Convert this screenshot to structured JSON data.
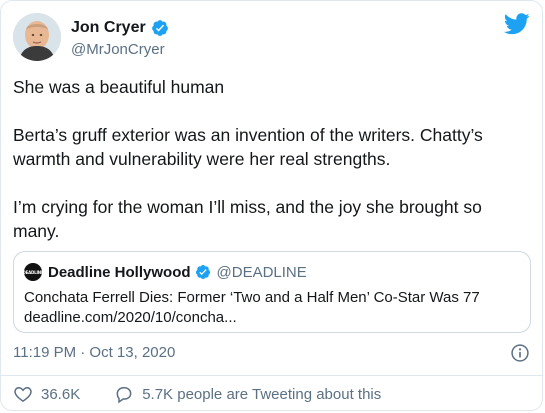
{
  "author": {
    "display_name": "Jon Cryer",
    "handle": "@MrJonCryer",
    "avatar_icon": "person-avatar"
  },
  "tweet": {
    "paragraphs": [
      "She was a beautiful human",
      "Berta’s gruff exterior was an invention of the writers. Chatty’s warmth and vulnerability were her real strengths.",
      "I’m crying for the woman I’ll miss, and the joy she brought so many."
    ],
    "timestamp": "11:19 PM · Oct 13, 2020"
  },
  "quoted": {
    "avatar_text": "DEADLINE",
    "display_name": "Deadline Hollywood",
    "handle": "@DEADLINE",
    "headline": "Conchata Ferrell Dies: Former ‘Two and a Half Men’ Co-Star Was 77",
    "link": "deadline.com/2020/10/concha..."
  },
  "actions": {
    "likes": "36.6K",
    "conversation": "5.7K people are Tweeting about this"
  },
  "colors": {
    "verified": "#1da1f2",
    "twitter_blue": "#1da1f2",
    "secondary_text": "#5b7083"
  }
}
